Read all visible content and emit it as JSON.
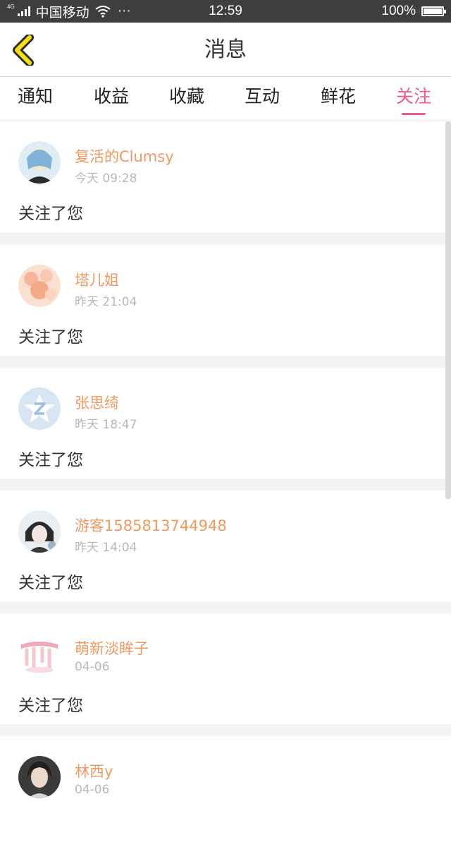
{
  "status_bar": {
    "network": "4G",
    "carrier": "中国移动",
    "more": "···",
    "time": "12:59",
    "battery": "100%",
    "battery_level": 1.0
  },
  "header": {
    "title": "消息",
    "back_icon": "chevron-left-icon",
    "accent_color": "#f5e011"
  },
  "tabs": [
    {
      "label": "通知",
      "active": false
    },
    {
      "label": "收益",
      "active": false
    },
    {
      "label": "收藏",
      "active": false
    },
    {
      "label": "互动",
      "active": false
    },
    {
      "label": "鲜花",
      "active": false
    },
    {
      "label": "关注",
      "active": true
    }
  ],
  "colors": {
    "active_tab": "#ee5a8f",
    "user_name": "#ee9a62",
    "timestamp": "#b8b8b8"
  },
  "messages": [
    {
      "name": "复活的Clumsy",
      "time": "今天 09:28",
      "text": "关注了您"
    },
    {
      "name": "塔儿姐",
      "time": "昨天 21:04",
      "text": "关注了您"
    },
    {
      "name": "张思绮",
      "time": "昨天 18:47",
      "text": "关注了您"
    },
    {
      "name": "游客1585813744948",
      "time": "昨天 14:04",
      "text": "关注了您"
    },
    {
      "name": "萌新淡眸子",
      "time": "04-06",
      "text": "关注了您"
    },
    {
      "name": "林西y",
      "time": "04-06",
      "text": ""
    }
  ]
}
